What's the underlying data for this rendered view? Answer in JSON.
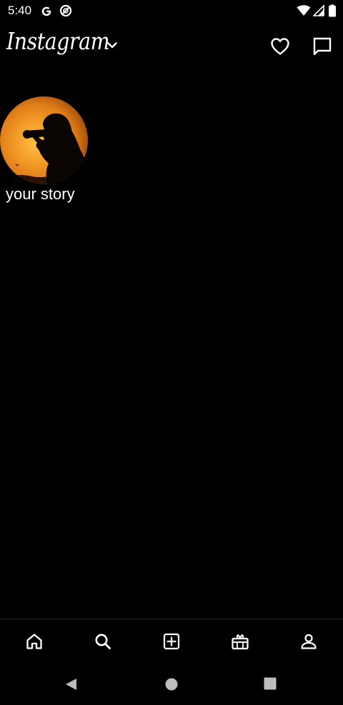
{
  "status_bar": {
    "time": "5:40",
    "icons": [
      "google-g-icon",
      "data-saver-icon",
      "wifi-icon",
      "signal-icon",
      "battery-icon"
    ]
  },
  "top_bar": {
    "logo_text": "Instagram",
    "icons": [
      "chevron-down-icon",
      "heart-icon",
      "messenger-icon"
    ]
  },
  "stories": [
    {
      "label": "your story",
      "avatar": "silhouette-with-camera-at-sunset"
    }
  ],
  "bottom_nav": {
    "items": [
      "home-icon",
      "search-icon",
      "create-post-icon",
      "shop-icon",
      "profile-icon"
    ]
  },
  "system_nav": {
    "items": [
      "back-icon",
      "home-circle-icon",
      "recents-icon"
    ]
  },
  "colors": {
    "background": "#000000",
    "foreground": "#ffffff",
    "divider": "#262626",
    "system_nav_icons": "#bdbdbd"
  }
}
